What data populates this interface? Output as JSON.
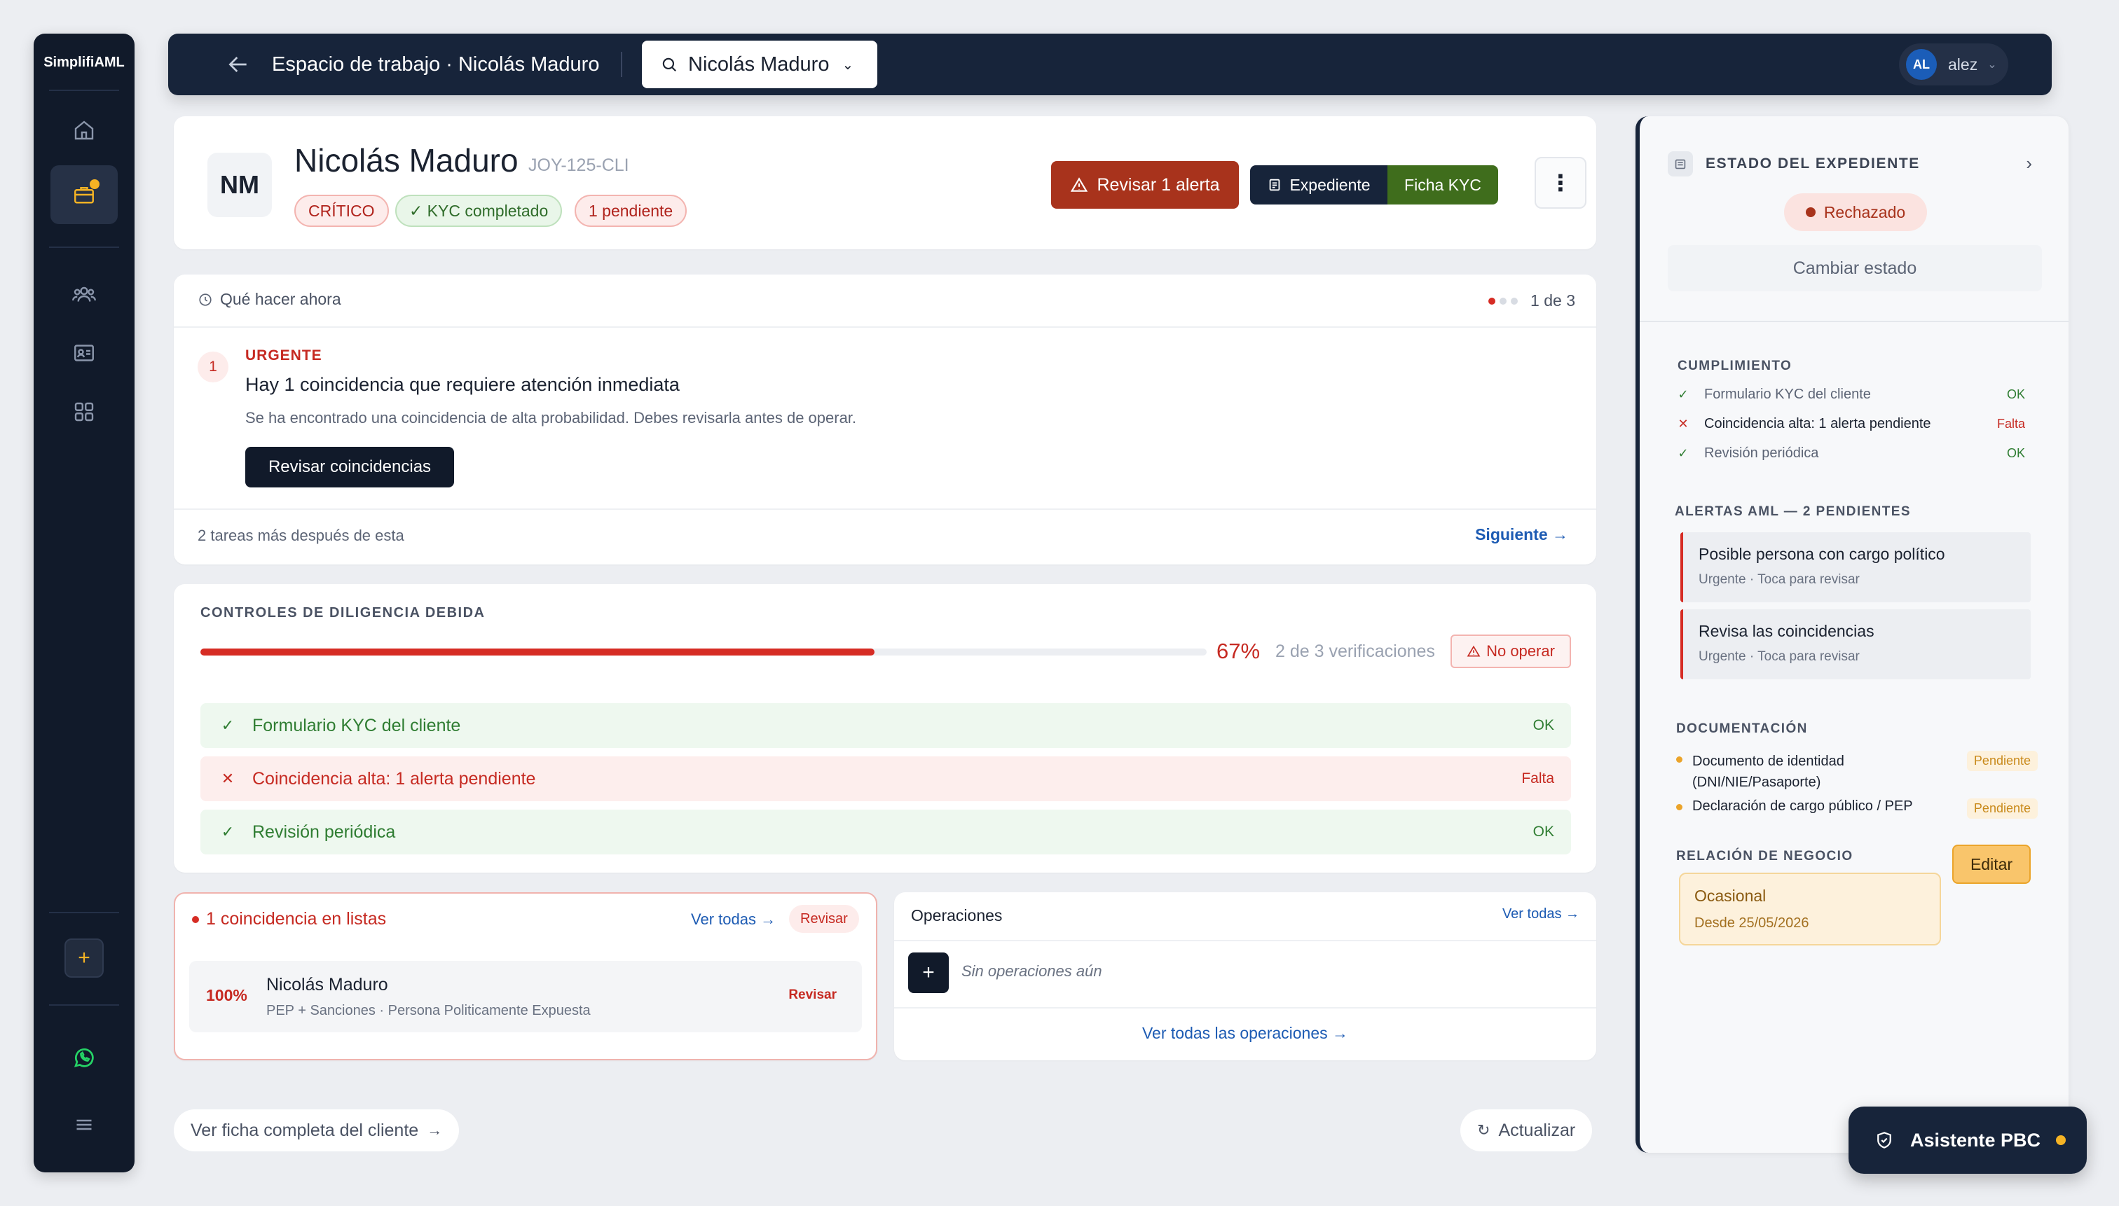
{
  "sidebar": {
    "brand": "SimplifiAML",
    "items": [
      {
        "name": "home-icon"
      },
      {
        "name": "briefcase-icon",
        "active": true
      },
      {
        "name": "users-icon"
      },
      {
        "name": "id-card-icon"
      },
      {
        "name": "grid-icon"
      }
    ],
    "add_label": "+"
  },
  "topbar": {
    "title": "Espacio de trabajo · Nicolás Maduro",
    "search_value": "Nicolás Maduro",
    "user_initials": "AL",
    "user_name": "alez"
  },
  "client": {
    "initials": "NM",
    "name": "Nicolás Maduro",
    "code": "JOY-125-CLI",
    "tags": [
      "CRÍTICO",
      "✓ KYC completado",
      "1 pendiente"
    ],
    "alert_button": "Revisar 1 alerta",
    "expediente_button": "Expediente",
    "ficha_button": "Ficha KYC",
    "more_label": "⋮"
  },
  "todo": {
    "heading": "Qué hacer ahora",
    "steps": "1 de 3",
    "number": "1",
    "urgency": "URGENTE",
    "title": "Hay 1 coincidencia que requiere atención inmediata",
    "description": "Se ha encontrado una coincidencia de alta probabilidad. Debes revisarla antes de operar.",
    "action": "Revisar coincidencias",
    "more_tasks": "2 tareas más después de esta",
    "next": "Siguiente →"
  },
  "due_diligence": {
    "title": "CONTROLES DE DILIGENCIA DEBIDA",
    "progress": 0.67,
    "percent_label": "67%",
    "count_label": "2 de 3 verificaciones",
    "no_operate": "No operar",
    "checks": [
      {
        "label": "Formulario KYC del cliente",
        "status": "OK",
        "ok": true
      },
      {
        "label": "Coincidencia alta: 1 alerta pendiente",
        "status": "Falta",
        "ok": false
      },
      {
        "label": "Revisión periódica",
        "status": "OK",
        "ok": true
      }
    ]
  },
  "lists": {
    "title": "1 coincidencia en listas",
    "see_all": "Ver todas →",
    "review": "Revisar",
    "match": {
      "percent": "100%",
      "name": "Nicolás Maduro",
      "detail": "PEP + Sanciones · Persona Politicamente Expuesta",
      "review": "Revisar"
    }
  },
  "operations": {
    "title": "Operaciones",
    "see_all": "Ver todas →",
    "add": "+",
    "empty": "Sin operaciones aún",
    "all_link": "Ver todas las operaciones →"
  },
  "footer": {
    "full_profile": "Ver ficha completa del cliente",
    "refresh": "Actualizar"
  },
  "status_panel": {
    "title": "ESTADO DEL EXPEDIENTE",
    "status": "Rechazado",
    "change": "Cambiar estado",
    "compliance_title": "CUMPLIMIENTO",
    "compliance": [
      {
        "label": "Formulario KYC del cliente",
        "status": "OK",
        "ok": true
      },
      {
        "label": "Coincidencia alta: 1 alerta pendiente",
        "status": "Falta",
        "ok": false
      },
      {
        "label": "Revisión periódica",
        "status": "OK",
        "ok": true
      }
    ],
    "alerts_title": "ALERTAS AML — 2 PENDIENTES",
    "alerts": [
      {
        "title": "Posible persona con cargo político",
        "sub": "Urgente · Toca para revisar"
      },
      {
        "title": "Revisa las coincidencias",
        "sub": "Urgente · Toca para revisar"
      }
    ],
    "docs_title": "DOCUMENTACIÓN",
    "docs": [
      {
        "label": "Documento de identidad (DNI/NIE/Pasaporte)",
        "status": "Pendiente"
      },
      {
        "label": "Declaración de cargo público / PEP",
        "status": "Pendiente"
      }
    ],
    "relation_title": "RELACIÓN DE NEGOCIO",
    "edit": "Editar",
    "relation_type": "Ocasional",
    "relation_since": "Desde 25/05/2026"
  },
  "assistant": {
    "label": "Asistente PBC"
  },
  "colors": {
    "accent_red": "#d62c24",
    "navy": "#17243a",
    "green": "#3f6d1c",
    "amber": "#f9c56b"
  }
}
